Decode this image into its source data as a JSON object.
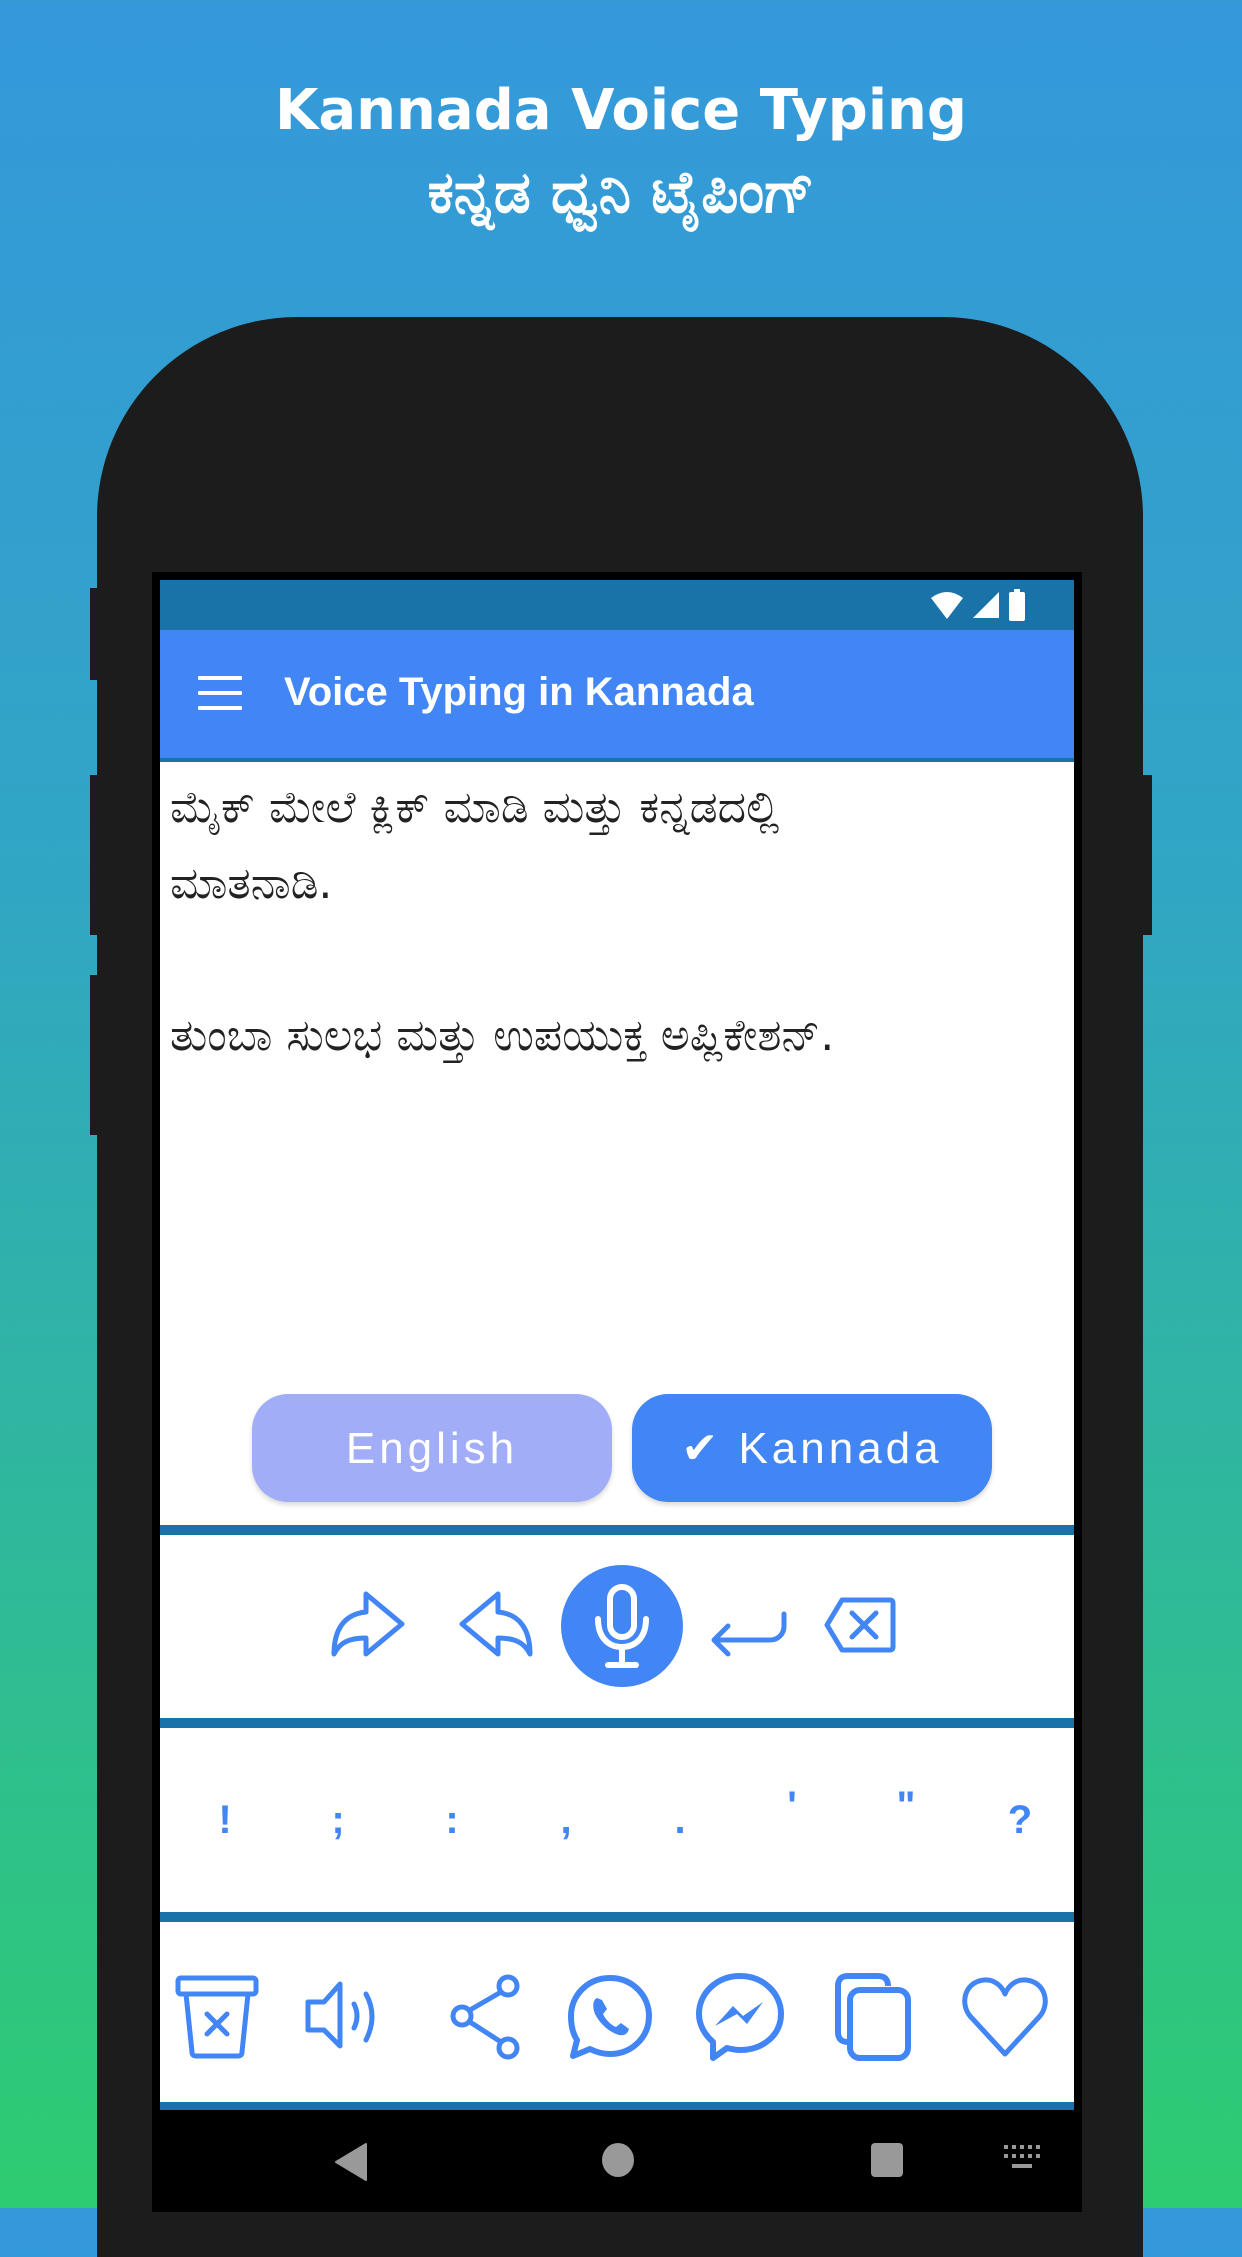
{
  "promo": {
    "title_en": "Kannada Voice Typing",
    "title_kn": "ಕನ್ನಡ ಧ್ವನಿ ಟೈಪಿಂಗ್"
  },
  "status_bar": {
    "icons": [
      "wifi-icon",
      "cell-signal-icon",
      "battery-icon"
    ]
  },
  "app_bar": {
    "menu_icon": "hamburger-menu-icon",
    "title": "Voice Typing in Kannada"
  },
  "editor": {
    "text": "ಮೈಕ್ ಮೇಲೆ ಕ್ಲಿಕ್ ಮಾಡಿ ಮತ್ತು ಕನ್ನಡದಲ್ಲಿ\nಮಾತನಾಡಿ.\n\nತುಂಬಾ ಸುಲಭ ಮತ್ತು ಉಪಯುಕ್ತ ಅಪ್ಲಿಕೇಶನ್."
  },
  "language": {
    "english_label": "English",
    "kannada_label": "✔ Kannada",
    "selected": "Kannada"
  },
  "toolbar": {
    "items": [
      "redo-icon",
      "undo-icon",
      "microphone-icon",
      "enter-icon",
      "backspace-icon"
    ]
  },
  "punctuation": {
    "keys": [
      "!",
      ";",
      ":",
      ",",
      ".",
      "'",
      "\"",
      "?"
    ]
  },
  "actions": {
    "items": [
      "clear-icon",
      "speak-icon",
      "share-icon",
      "whatsapp-icon",
      "messenger-icon",
      "copy-icon",
      "favorite-icon"
    ]
  },
  "nav_bar": {
    "items": [
      "back-icon",
      "home-icon",
      "recents-icon",
      "keyboard-icon"
    ]
  },
  "colors": {
    "primary": "#4285f4",
    "primary_dark": "#1a73a8",
    "english_button": "#a1adf7",
    "gradient_top": "#3498db",
    "gradient_bottom": "#2ecc71"
  }
}
